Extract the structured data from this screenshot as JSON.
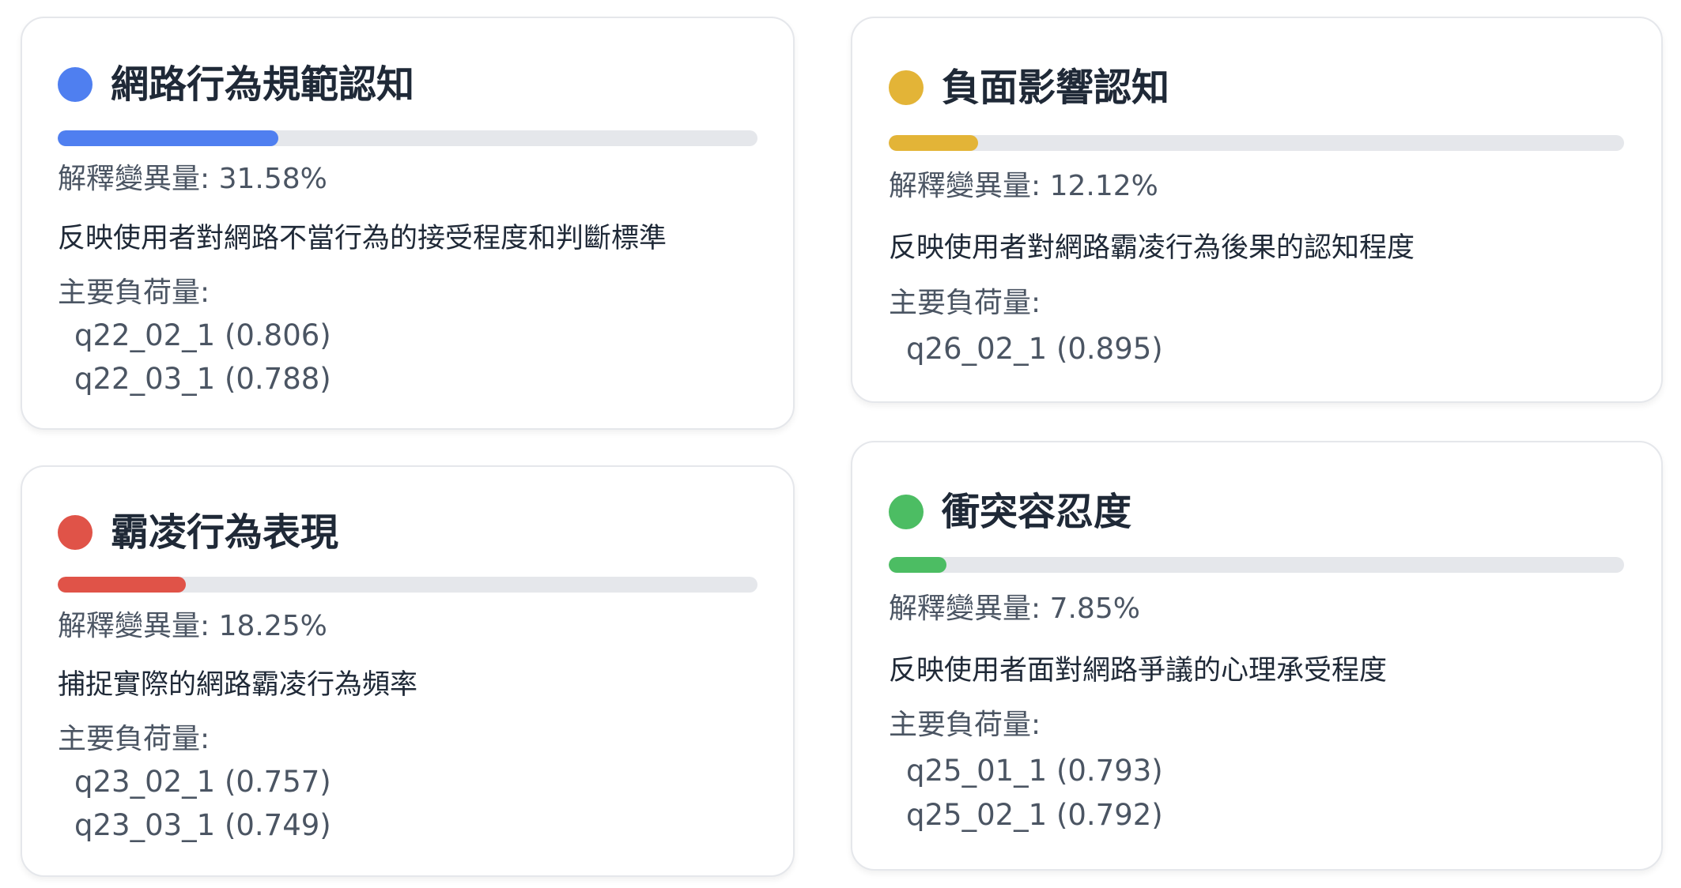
{
  "common": {
    "variance_label": "解釋變異量: ",
    "loadings_label": "主要負荷量:"
  },
  "factors": [
    {
      "title": "網路行為規範認知",
      "color": "#4f7ff0",
      "variance_text": "31.58%",
      "variance_percent": 31.58,
      "description": "反映使用者對網路不當行為的接受程度和判斷標準",
      "loadings": [
        "q22_02_1 (0.806)",
        "q22_03_1 (0.788)"
      ]
    },
    {
      "title": "負面影響認知",
      "color": "#e3b437",
      "variance_text": "12.12%",
      "variance_percent": 12.12,
      "description": "反映使用者對網路霸凌行為後果的認知程度",
      "loadings": [
        "q26_02_1 (0.895)"
      ]
    },
    {
      "title": "霸凌行為表現",
      "color": "#e05348",
      "variance_text": "18.25%",
      "variance_percent": 18.25,
      "description": "捕捉實際的網路霸凌行為頻率",
      "loadings": [
        "q23_02_1 (0.757)",
        "q23_03_1 (0.749)"
      ]
    },
    {
      "title": "衝突容忍度",
      "color": "#4cbd63",
      "variance_text": "7.85%",
      "variance_percent": 7.85,
      "description": "反映使用者面對網路爭議的心理承受程度",
      "loadings": [
        "q25_01_1 (0.793)",
        "q25_02_1 (0.792)"
      ]
    }
  ]
}
